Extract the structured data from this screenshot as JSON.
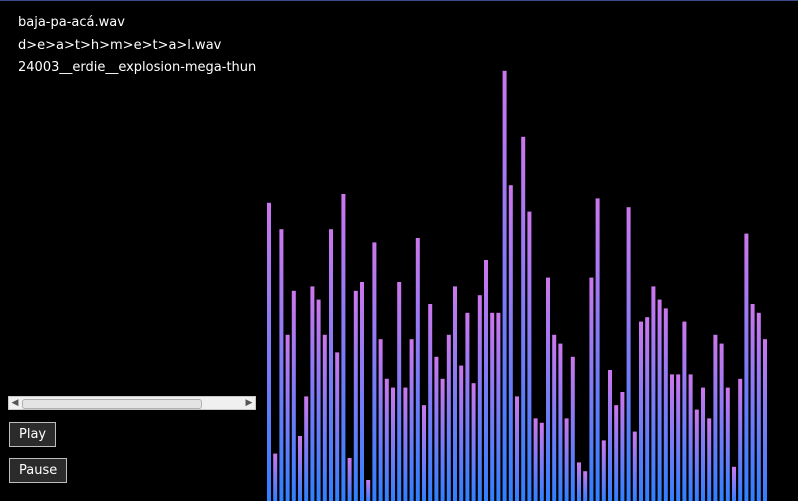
{
  "playlist": {
    "items": [
      "baja-pa-acá.wav",
      "d>e>a>t>h>m>e>t>a>l.wav",
      "24003__erdie__explosion-mega-thun"
    ]
  },
  "controls": {
    "play_label": "Play",
    "pause_label": "Pause"
  },
  "visualizer": {
    "colors": {
      "low": "#2f7fff",
      "high": "#cc77ee"
    },
    "levels": [
      0.68,
      0.11,
      0.62,
      0.38,
      0.48,
      0.15,
      0.24,
      0.49,
      0.46,
      0.38,
      0.62,
      0.34,
      0.7,
      0.1,
      0.48,
      0.5,
      0.05,
      0.59,
      0.37,
      0.28,
      0.26,
      0.5,
      0.26,
      0.37,
      0.6,
      0.22,
      0.45,
      0.33,
      0.28,
      0.38,
      0.49,
      0.31,
      0.43,
      0.27,
      0.47,
      0.55,
      0.43,
      0.43,
      0.98,
      0.72,
      0.24,
      0.83,
      0.66,
      0.19,
      0.18,
      0.51,
      0.38,
      0.36,
      0.19,
      0.33,
      0.09,
      0.07,
      0.51,
      0.69,
      0.14,
      0.3,
      0.22,
      0.25,
      0.67,
      0.16,
      0.41,
      0.42,
      0.49,
      0.46,
      0.44,
      0.29,
      0.29,
      0.41,
      0.29,
      0.21,
      0.26,
      0.19,
      0.38,
      0.36,
      0.26,
      0.08,
      0.28,
      0.61,
      0.45,
      0.43,
      0.37
    ]
  }
}
